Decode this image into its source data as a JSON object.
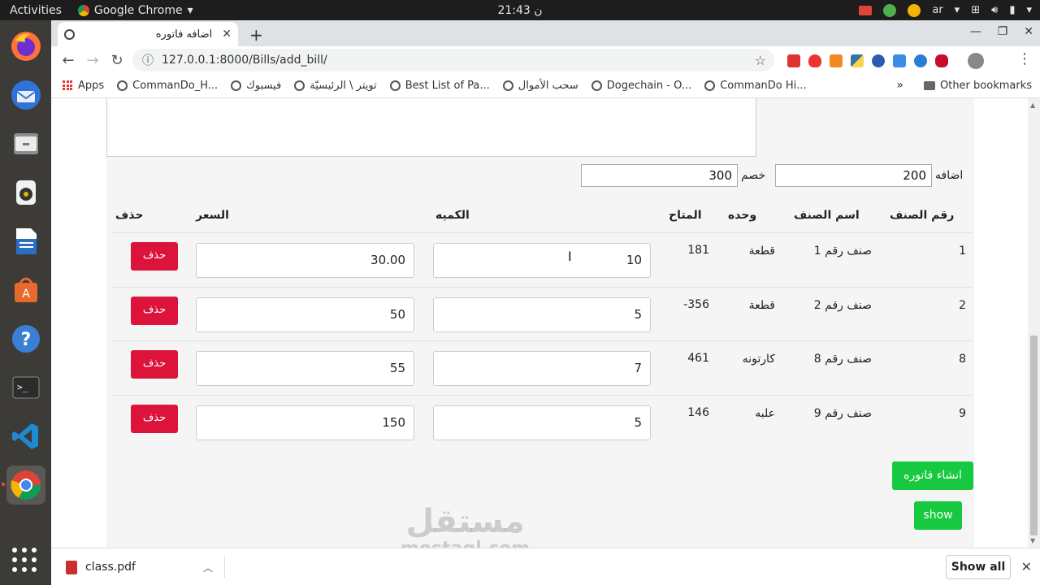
{
  "topbar": {
    "activities": "Activities",
    "app_name": "Google Chrome",
    "clock": "21:43 ن",
    "lang": "ar"
  },
  "browser": {
    "tab_title": "اضافه فاتوره",
    "url": "127.0.0.1:8000/Bills/add_bill/",
    "bookmarks": [
      "Apps",
      "CommanDo_H...",
      "فيسبوك",
      "تويتر \\ الرئيسيّة",
      "Best List of Pa...",
      "سحب الأموال",
      "Dogechain - O...",
      "CommanDo Hi..."
    ],
    "bookmarks_more": "»",
    "other_bookmarks": "Other bookmarks"
  },
  "form": {
    "addition_label": "اضافه",
    "addition_value": "200",
    "discount_label": "خصم",
    "discount_value": "300"
  },
  "table": {
    "headers": {
      "item_no": "رقم الصنف",
      "item_name": "اسم الصنف",
      "unit": "وحده",
      "available": "المتاح",
      "quantity": "الكميه",
      "price": "السعر",
      "delete": "حذف"
    },
    "rows": [
      {
        "item_no": "1",
        "item_name": "صنف رقم 1",
        "unit": "قطعة",
        "available": "181",
        "quantity": "10",
        "price": "30.00",
        "delete": "حذف"
      },
      {
        "item_no": "2",
        "item_name": "صنف رقم 2",
        "unit": "قطعة",
        "available": "356-",
        "quantity": "5",
        "price": "50",
        "delete": "حذف"
      },
      {
        "item_no": "8",
        "item_name": "صنف رقم 8",
        "unit": "كارتونه",
        "available": "461",
        "quantity": "7",
        "price": "55",
        "delete": "حذف"
      },
      {
        "item_no": "9",
        "item_name": "صنف رقم 9",
        "unit": "علبه",
        "available": "146",
        "quantity": "5",
        "price": "150",
        "delete": "حذف"
      }
    ]
  },
  "actions": {
    "create_invoice": "انشاء فاتوره",
    "show": "show"
  },
  "watermark": {
    "arabic": "مستقل",
    "latin": "mostaql.com"
  },
  "downloads": {
    "file": "class.pdf",
    "show_all": "Show all"
  }
}
